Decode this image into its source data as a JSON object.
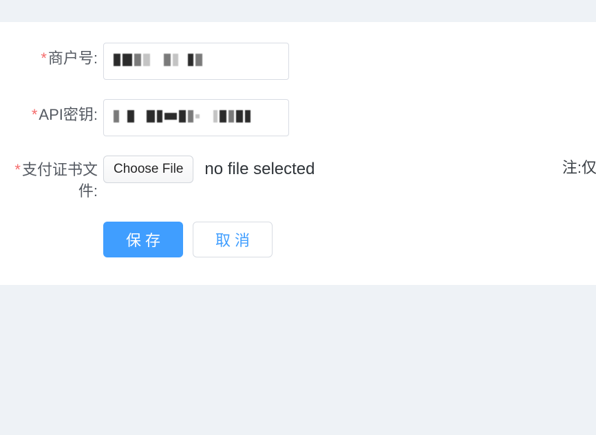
{
  "form": {
    "merchant_id": {
      "label": "商户号:",
      "value": "[redacted]"
    },
    "api_key": {
      "label": "API密钥:",
      "value": "[redacted]"
    },
    "cert_file": {
      "label": "支付证书文件:",
      "choose_button": "Choose File",
      "no_file_text": "no file selected",
      "note_prefix": "注:仅"
    }
  },
  "actions": {
    "save": "保存",
    "cancel": "取消"
  }
}
